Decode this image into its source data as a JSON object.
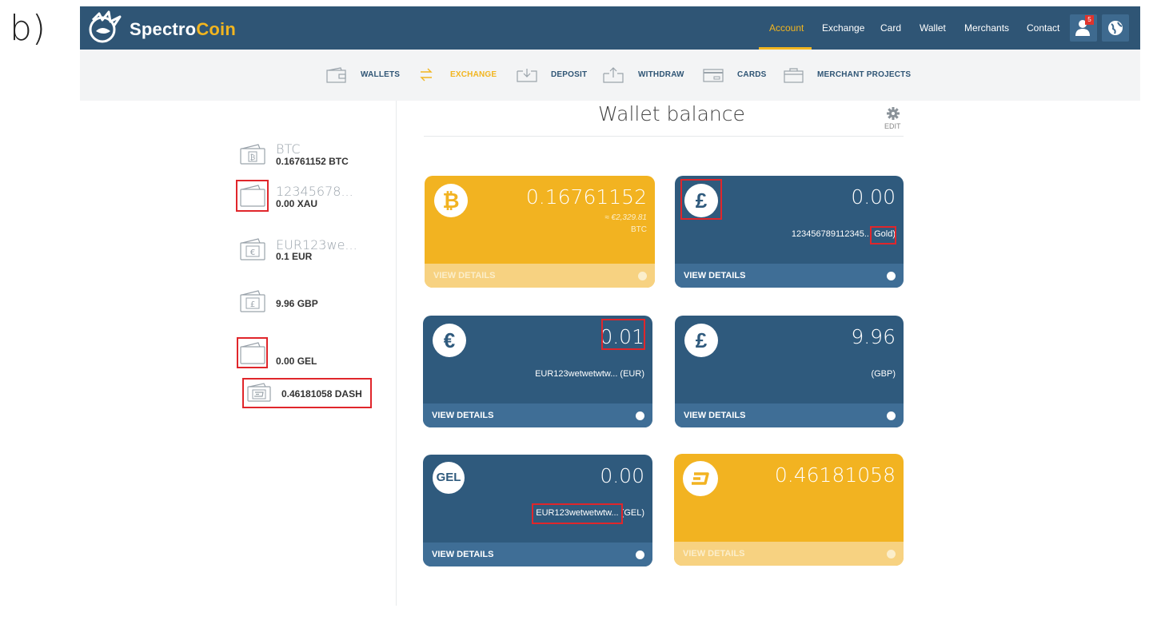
{
  "panel_label": "b)",
  "brand": {
    "part1": "Spectro",
    "part2": "Coin"
  },
  "top_nav": [
    "Account",
    "Exchange",
    "Card",
    "Wallet",
    "Merchants",
    "Contact"
  ],
  "notification_count": "5",
  "sub_nav": [
    "WALLETS",
    "EXCHANGE",
    "DEPOSIT",
    "WITHDRAW",
    "CARDS",
    "MERCHANT PROJECTS"
  ],
  "page": {
    "title": "Wallet balance",
    "edit": "EDIT"
  },
  "sidebar": [
    {
      "name": "BTC",
      "amount": "0.16761152 BTC"
    },
    {
      "name": "12345678...",
      "amount": "0.00 XAU"
    },
    {
      "name": "EUR123we...",
      "amount": "0.1 EUR"
    },
    {
      "name": "",
      "amount": "9.96 GBP"
    },
    {
      "name": "",
      "amount": "0.00 GEL"
    },
    {
      "name": "",
      "amount": "0.46181058 DASH"
    }
  ],
  "cards": [
    {
      "symbol": "₿",
      "balance": "0.16761152",
      "line1": "≈ €2,329.81",
      "line2": "BTC",
      "view": "VIEW DETAILS"
    },
    {
      "symbol": "£",
      "balance": "0.00",
      "line1": "123456789112345... Gold)",
      "line2": "",
      "view": "VIEW DETAILS"
    },
    {
      "symbol": "€",
      "balance": "0.01",
      "line1": "EUR123wetwetwtw... (EUR)",
      "line2": "",
      "view": "VIEW DETAILS"
    },
    {
      "symbol": "£",
      "balance": "9.96",
      "line1": "(GBP)",
      "line2": "",
      "view": "VIEW DETAILS"
    },
    {
      "symbol": "GEL",
      "balance": "0.00",
      "line1": "EUR123wetwetwtw... (GEL)",
      "line2": "",
      "view": "VIEW DETAILS"
    },
    {
      "symbol": "D",
      "balance": "0.46181058",
      "line1": "",
      "line2": "",
      "view": "VIEW DETAILS"
    }
  ],
  "colors": {
    "navy": "#2f5575",
    "gold": "#f2b321",
    "card_blue": "#2f5a7d",
    "highlight_red": "#e0262b"
  }
}
